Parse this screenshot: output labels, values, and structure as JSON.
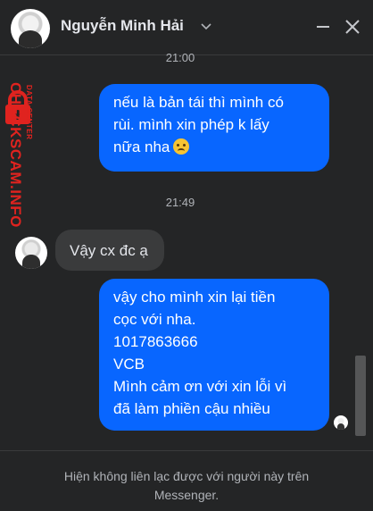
{
  "header": {
    "contact_name": "Nguyễn Minh Hải"
  },
  "watermark": {
    "main": "CHECKSCAM.INFO",
    "sub": "DATA CENTER"
  },
  "messages": [
    {
      "type": "timestamp",
      "text": "21:00"
    },
    {
      "type": "outgoing",
      "lines": [
        "nếu là bản tái thì mình có",
        "rùi. mình xin phép k lấy",
        "nữa nha"
      ],
      "emoji": "frowning-face"
    },
    {
      "type": "timestamp",
      "text": "21:49"
    },
    {
      "type": "incoming",
      "lines": [
        "Vậy cx đc ạ"
      ]
    },
    {
      "type": "outgoing",
      "lines": [
        "vậy cho mình xin lại tiền",
        "cọc với nha.",
        "1017863666",
        "VCB",
        "Mình cảm ơn với xin lỗi vì",
        "đã làm phiền cậu nhiều"
      ]
    }
  ],
  "footer": {
    "lines": [
      "Hiện không liên lạc được với người này trên",
      "Messenger."
    ]
  },
  "colors": {
    "background": "#242526",
    "outgoing_bubble": "#0866ff",
    "incoming_bubble": "#3a3b3c",
    "watermark": "#e0231f"
  }
}
